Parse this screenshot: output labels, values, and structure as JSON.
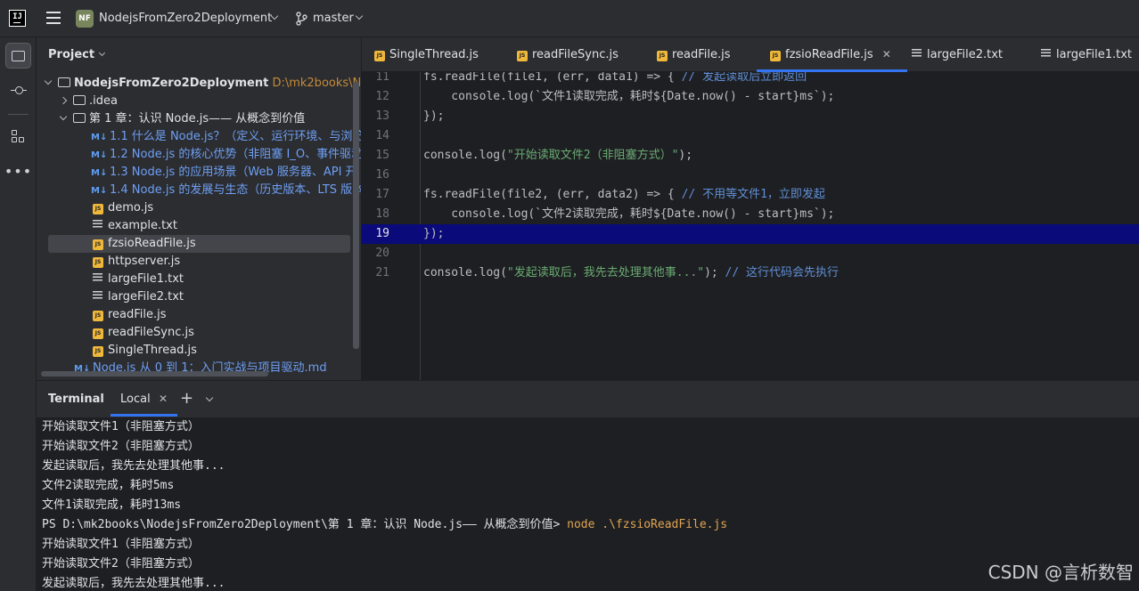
{
  "titlebar": {
    "project_badge": "NF",
    "project_name": "NodejsFromZero2Deployment",
    "branch": "master"
  },
  "project_panel": {
    "header": "Project",
    "root": {
      "name": "NodejsFromZero2Deployment",
      "path": "D:\\mk2books\\Node"
    },
    "items": [
      {
        "label": ".idea",
        "type": "folder"
      },
      {
        "label": "第 1 章：认识 Node.js—— 从概念到价值",
        "type": "folder"
      },
      {
        "label": "1.1 什么是 Node.js？（定义、运行环境、与浏览",
        "type": "md"
      },
      {
        "label": "1.2 Node.js 的核心优势（非阻塞 I_O、事件驱动",
        "type": "md"
      },
      {
        "label": "1.3 Node.js 的应用场景（Web 服务器、API 开",
        "type": "md"
      },
      {
        "label": "1.4 Node.js 的发展与生态（历史版本、LTS 版本",
        "type": "md"
      },
      {
        "label": "demo.js",
        "type": "js"
      },
      {
        "label": "example.txt",
        "type": "txt"
      },
      {
        "label": "fzsioReadFile.js",
        "type": "js"
      },
      {
        "label": "httpserver.js",
        "type": "js"
      },
      {
        "label": "largeFile1.txt",
        "type": "txt"
      },
      {
        "label": "largeFile2.txt",
        "type": "txt"
      },
      {
        "label": "readFile.js",
        "type": "js"
      },
      {
        "label": "readFileSync.js",
        "type": "js"
      },
      {
        "label": "SingleThread.js",
        "type": "js"
      },
      {
        "label": "Node.js 从 0 到 1：入门实战与项目驱动.md",
        "type": "md"
      }
    ]
  },
  "tabs": [
    {
      "label": "SingleThread.js",
      "type": "js"
    },
    {
      "label": "readFileSync.js",
      "type": "js"
    },
    {
      "label": "readFile.js",
      "type": "js"
    },
    {
      "label": "fzsioReadFile.js",
      "type": "js",
      "active": true
    },
    {
      "label": "largeFile2.txt",
      "type": "txt"
    },
    {
      "label": "largeFile1.txt",
      "type": "txt"
    }
  ],
  "editor": {
    "lines": [
      {
        "n": "11",
        "a": "fs.readFile(file1, (err, data1) => { ",
        "c": "// 发起读取后立即返回"
      },
      {
        "n": "12",
        "a": "    console.log(`文件1读取完成，耗时${Date.now() - start}ms`);"
      },
      {
        "n": "13",
        "a": "});"
      },
      {
        "n": "14",
        "a": ""
      },
      {
        "n": "15",
        "a": "console.log(",
        "s": "\"开始读取文件2（非阻塞方式）\"",
        "b": ");"
      },
      {
        "n": "16",
        "a": ""
      },
      {
        "n": "17",
        "a": "fs.readFile(file2, (err, data2) => { ",
        "c": "// 不用等文件1，立即发起"
      },
      {
        "n": "18",
        "a": "    console.log(`文件2读取完成，耗时${Date.now() - start}ms`);"
      },
      {
        "n": "19",
        "a": "});"
      },
      {
        "n": "20",
        "a": ""
      },
      {
        "n": "21",
        "a": "console.log(",
        "s": "\"发起读取后，我先去处理其他事...\"",
        "b": "); ",
        "c": "// 这行代码会先执行"
      }
    ],
    "current_line": "19"
  },
  "terminal": {
    "title": "Terminal",
    "tab": "Local",
    "lines": [
      "开始读取文件1（非阻塞方式）",
      "开始读取文件2（非阻塞方式）",
      "发起读取后，我先去处理其他事...",
      "文件2读取完成，耗时5ms",
      "文件1读取完成，耗时13ms",
      "PS D:\\mk2books\\NodejsFromZero2Deployment\\第 1 章：认识 Node.js—— 从概念到价值> ",
      "开始读取文件1（非阻塞方式）",
      "开始读取文件2（非阻塞方式）",
      "发起读取后，我先去处理其他事..."
    ],
    "prompt_command": "node .\\fzsioReadFile.js"
  },
  "watermark": "CSDN @言析数智",
  "colors": {
    "accent": "#3574f0",
    "current_line": "#0a0a7a",
    "js_icon": "#f0b83b"
  }
}
